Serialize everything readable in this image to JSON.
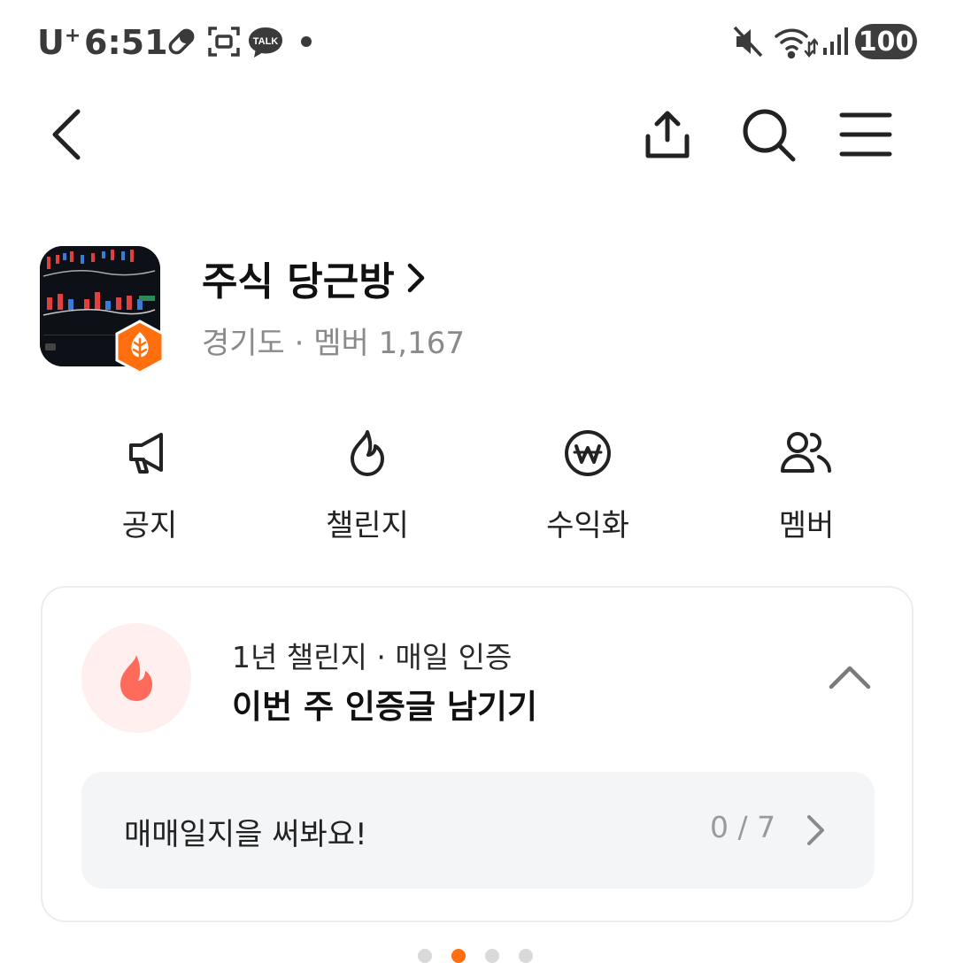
{
  "status_bar": {
    "carrier": "U",
    "carrier_sup": "+",
    "time": "6:51",
    "kakao_label": "TALK",
    "battery": "100",
    "icons": [
      "pill-icon",
      "screenshot-icon",
      "kakaotalk-icon",
      "dot-icon",
      "mute-icon",
      "wifi-icon",
      "signal-icon"
    ]
  },
  "top_nav": {
    "icons": [
      "back-icon",
      "share-icon",
      "search-icon",
      "menu-icon"
    ]
  },
  "community": {
    "name": "주식 당근방",
    "region": "경기도",
    "separator": "·",
    "members_label": "멤버 1,167",
    "accent_color": "#ff6f0f"
  },
  "quick_menu": [
    {
      "label": "공지",
      "icon": "megaphone-icon"
    },
    {
      "label": "챌린지",
      "icon": "fire-icon"
    },
    {
      "label": "수익화",
      "icon": "won-icon"
    },
    {
      "label": "멤버",
      "icon": "members-icon"
    }
  ],
  "challenge": {
    "meta": "1년 챌린지 · 매일 인증",
    "title": "이번 주 인증글 남기기",
    "task_label": "매매일지을 써봐요!",
    "progress": "0 / 7",
    "fire_color": "#ff6b5b"
  },
  "pager": {
    "count": 4,
    "active_index": 1
  }
}
